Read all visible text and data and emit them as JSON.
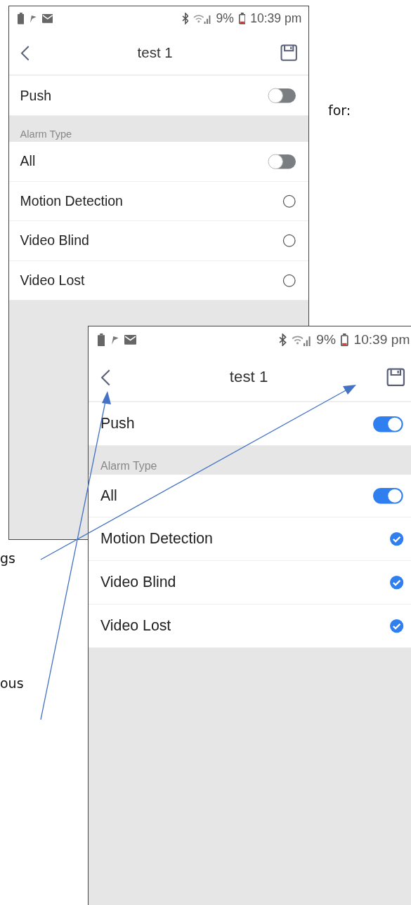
{
  "screens": [
    {
      "status_bar": {
        "battery": "9%",
        "time": "10:39 pm"
      },
      "title": "test 1",
      "push": {
        "label": "Push",
        "on": false
      },
      "section": "Alarm Type",
      "items": [
        {
          "kind": "switch",
          "label": "All",
          "on": false
        },
        {
          "kind": "radio",
          "label": "Motion Detection",
          "checked": false
        },
        {
          "kind": "radio",
          "label": "Video Blind",
          "checked": false
        },
        {
          "kind": "radio",
          "label": "Video Lost",
          "checked": false
        }
      ]
    },
    {
      "status_bar": {
        "battery": "9%",
        "time": "10:39 pm"
      },
      "title": "test 1",
      "push": {
        "label": "Push",
        "on": true
      },
      "section": "Alarm Type",
      "items": [
        {
          "kind": "switch",
          "label": "All",
          "on": true
        },
        {
          "kind": "radio",
          "label": "Motion Detection",
          "checked": true
        },
        {
          "kind": "radio",
          "label": "Video Blind",
          "checked": true
        },
        {
          "kind": "radio",
          "label": "Video Lost",
          "checked": true
        }
      ]
    }
  ],
  "notes": [
    "for:",
    "gs",
    "ous"
  ]
}
